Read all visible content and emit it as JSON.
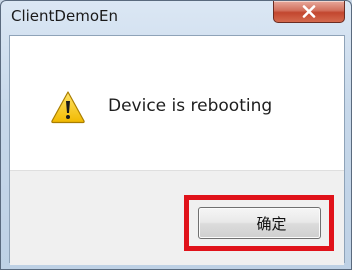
{
  "window": {
    "title": "ClientDemoEn",
    "close_icon": "close-icon"
  },
  "dialog": {
    "icon": "warning-icon",
    "message": "Device is rebooting",
    "ok_label": "确定"
  },
  "colors": {
    "highlight": "#e0121a",
    "warning_fill": "#f5c400",
    "close_button": "#c2462f"
  }
}
